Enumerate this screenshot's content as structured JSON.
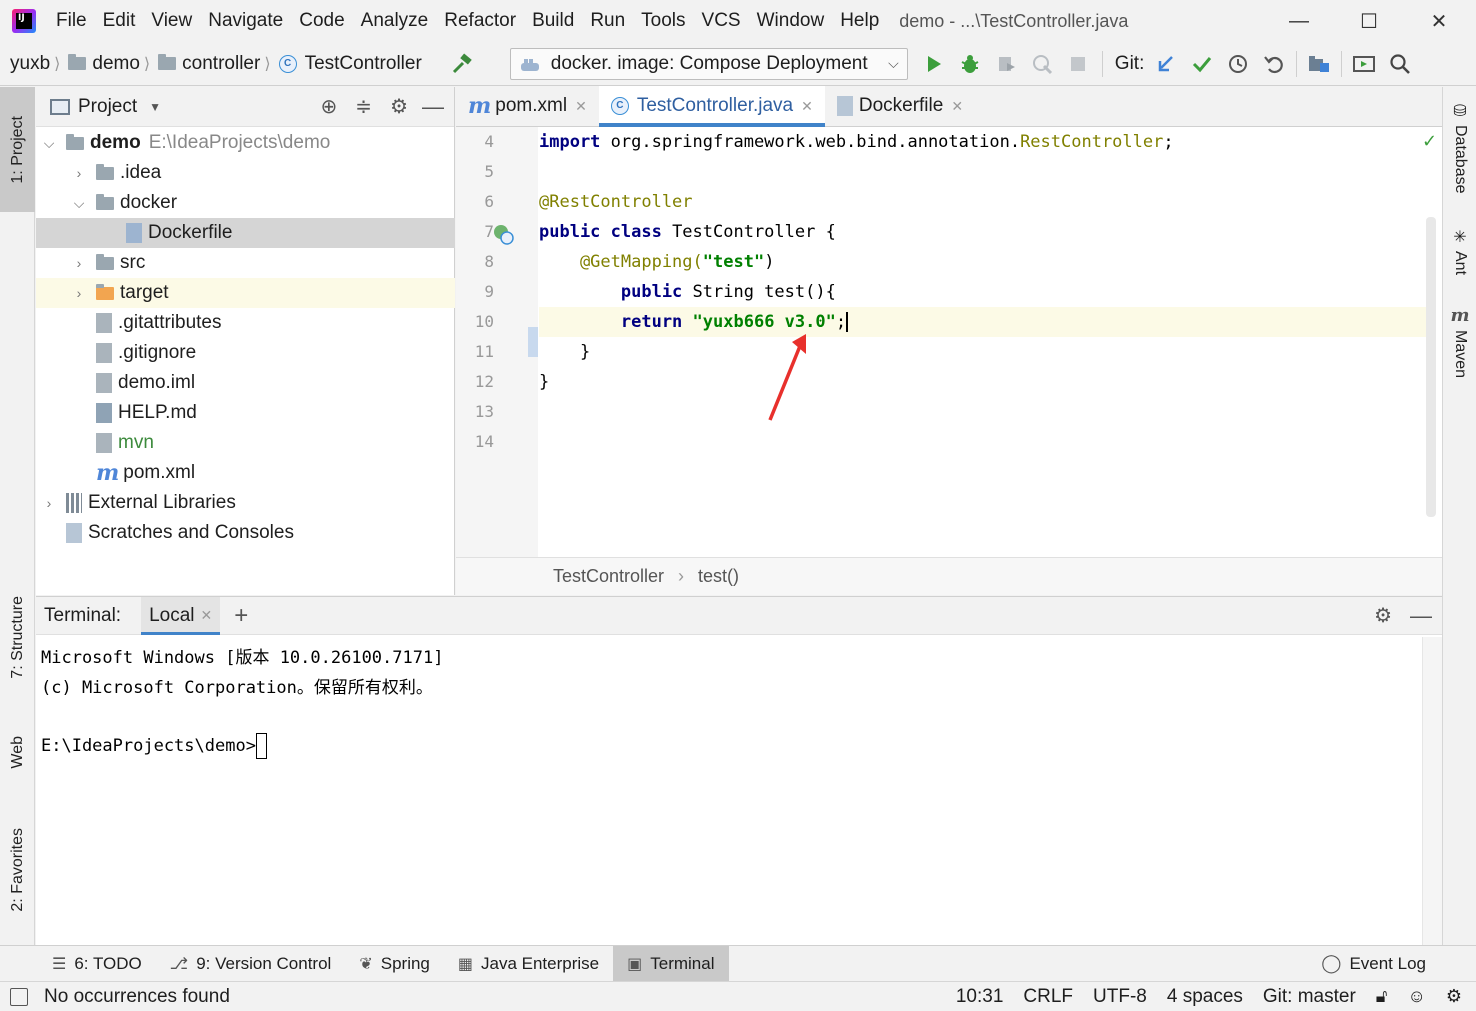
{
  "window": {
    "title": "demo - ...\\TestController.java",
    "menu": [
      "File",
      "Edit",
      "View",
      "Navigate",
      "Code",
      "Analyze",
      "Refactor",
      "Build",
      "Run",
      "Tools",
      "VCS",
      "Window",
      "Help"
    ],
    "menu_mnemonic": [
      "F",
      "E",
      "V",
      "N",
      "C",
      "z",
      "R",
      "B",
      "u",
      "T",
      "S",
      "W",
      "H"
    ],
    "minimize": "—",
    "maximize": "☐",
    "close": "✕"
  },
  "navbar": {
    "crumbs": [
      "yuxb",
      "demo",
      "controller",
      "TestController"
    ],
    "run_config": "docker.  image: Compose Deployment",
    "git_label": "Git:"
  },
  "left_stripe": {
    "project": "1: Project",
    "structure": "7: Structure",
    "web": "Web",
    "favorites": "2: Favorites"
  },
  "right_stripe": {
    "database": "Database",
    "ant": "Ant",
    "maven": "Maven"
  },
  "project": {
    "title": "Project",
    "tree": [
      {
        "label": "demo",
        "path": "E:\\IdeaProjects\\demo",
        "depth": 0,
        "arrow": "⌵"
      },
      {
        "label": ".idea",
        "depth": 1,
        "arrow": "›"
      },
      {
        "label": "docker",
        "depth": 1,
        "arrow": "⌵"
      },
      {
        "label": "Dockerfile",
        "depth": 2,
        "arrow": ""
      },
      {
        "label": "src",
        "depth": 1,
        "arrow": "›"
      },
      {
        "label": "target",
        "depth": 1,
        "arrow": "›"
      },
      {
        "label": ".gitattributes",
        "depth": 1,
        "arrow": ""
      },
      {
        "label": ".gitignore",
        "depth": 1,
        "arrow": ""
      },
      {
        "label": "demo.iml",
        "depth": 1,
        "arrow": ""
      },
      {
        "label": "HELP.md",
        "depth": 1,
        "arrow": ""
      },
      {
        "label": "mvn",
        "depth": 1,
        "arrow": ""
      },
      {
        "label": "pom.xml",
        "depth": 1,
        "arrow": ""
      },
      {
        "label": "External Libraries",
        "depth": 0,
        "arrow": "›"
      },
      {
        "label": "Scratches and Consoles",
        "depth": 0,
        "arrow": ""
      }
    ]
  },
  "editor": {
    "tabs": [
      {
        "label": "pom.xml",
        "close": "✕"
      },
      {
        "label": "TestController.java",
        "close": "✕"
      },
      {
        "label": "Dockerfile",
        "close": "✕"
      }
    ],
    "line_numbers": [
      "4",
      "5",
      "6",
      "7",
      "8",
      "9",
      "10",
      "11",
      "12",
      "13",
      "14"
    ],
    "code": {
      "l4_kw": "import",
      "l4_pkg": " org.springframework.web.bind.annotation.",
      "l4_cls": "RestController",
      "l4_end": ";",
      "l6": "@RestController",
      "l7_kw": "public class",
      "l7_rest": " TestController {",
      "l8_ann": "    @GetMapping(",
      "l8_str": "\"test\"",
      "l8_end": ")",
      "l9_kw": "        public",
      "l9_rest": " String test(){",
      "l10_kw": "        return",
      "l10_sp": " ",
      "l10_str": "\"yuxb666 v3.0\"",
      "l10_end": ";",
      "l11": "    }",
      "l12": "}"
    },
    "breadcrumbs": [
      "TestController",
      "test()"
    ],
    "breadcrumb_sep": "›"
  },
  "terminal": {
    "title": "Terminal:",
    "tab": "Local",
    "tab_close": "✕",
    "add": "+",
    "lines": [
      "Microsoft Windows [版本 10.0.26100.7171]",
      "(c) Microsoft Corporation。保留所有权利。",
      "",
      "E:\\IdeaProjects\\demo>"
    ]
  },
  "bottom_tools": [
    {
      "label": "6: TODO",
      "icon": "☰"
    },
    {
      "label": "9: Version Control",
      "icon": "⎇"
    },
    {
      "label": "Spring",
      "icon": "❦"
    },
    {
      "label": "Java Enterprise",
      "icon": "▦"
    },
    {
      "label": "Terminal",
      "icon": "▣"
    }
  ],
  "event_log": "Event Log",
  "status": {
    "message": "No occurrences found",
    "position": "10:31",
    "line_sep": "CRLF",
    "encoding": "UTF-8",
    "indent": "4 spaces",
    "git": "Git: master"
  },
  "colors": {
    "accent": "#4083c9",
    "run_green": "#3c9e3c",
    "annotation_arrow": "#e8302c"
  }
}
